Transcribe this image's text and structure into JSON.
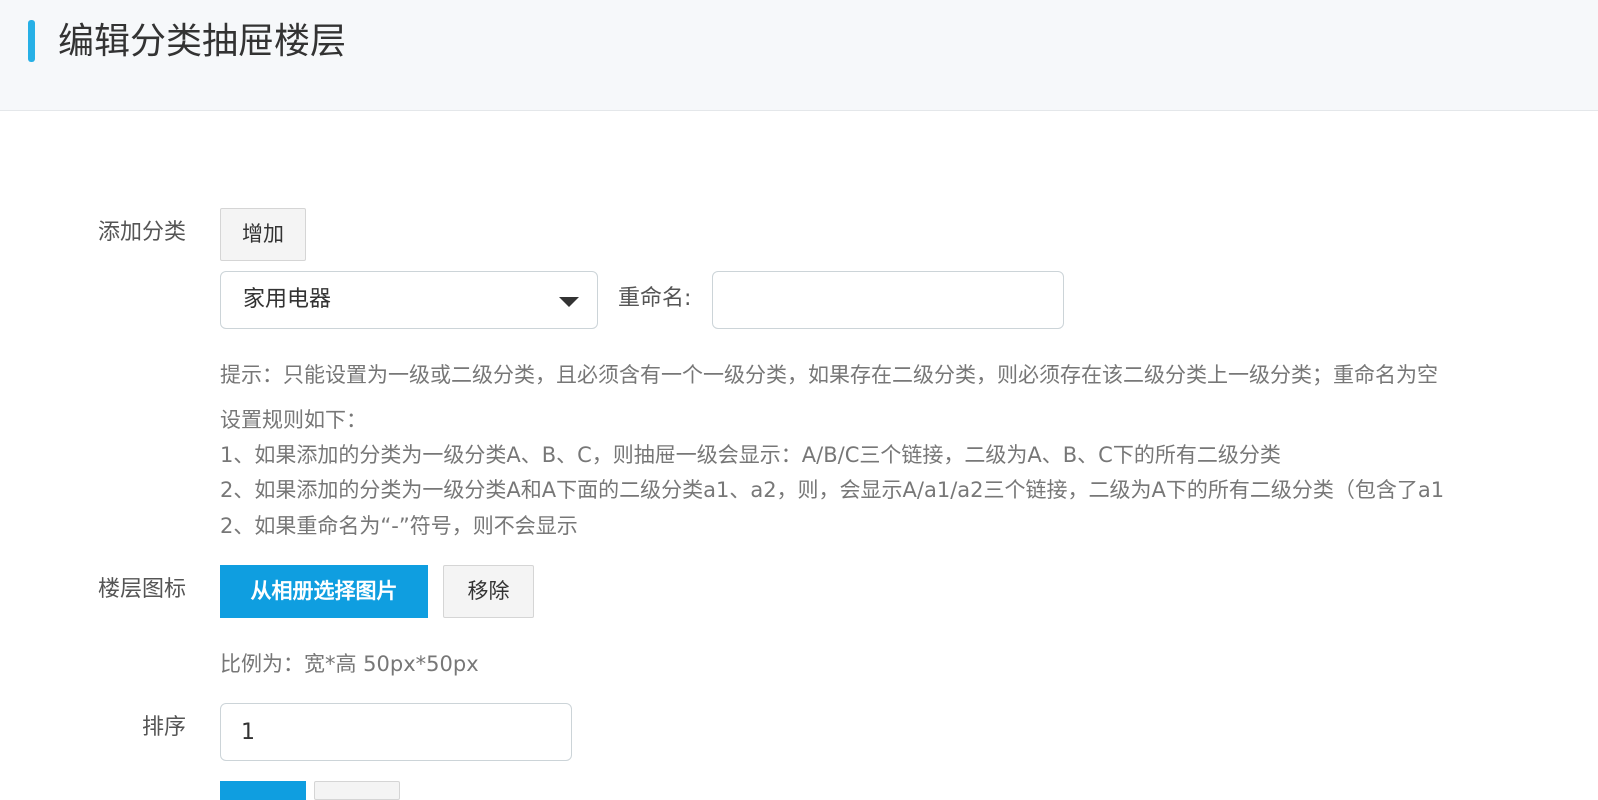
{
  "header": {
    "title": "编辑分类抽屉楼层"
  },
  "form": {
    "add_category": {
      "label": "添加分类",
      "add_button": "增加",
      "select_value": "家用电器",
      "rename_label": "重命名:",
      "rename_value": ""
    },
    "help": {
      "tip": "提示：只能设置为一级或二级分类，且必须含有一个一级分类，如果存在二级分类，则必须存在该二级分类上一级分类；重命名为空",
      "rules_title": "设置规则如下：",
      "rule1": "1、如果添加的分类为一级分类A、B、C，则抽屉一级会显示：A/B/C三个链接，二级为A、B、C下的所有二级分类",
      "rule2": "2、如果添加的分类为一级分类A和A下面的二级分类a1、a2，则，会显示A/a1/a2三个链接，二级为A下的所有二级分类（包含了a1",
      "rule3": "2、如果重命名为“-”符号，则不会显示"
    },
    "floor_icon": {
      "label": "楼层图标",
      "choose_button": "从相册选择图片",
      "remove_button": "移除",
      "ratio_hint": "比例为：宽*高 50px*50px"
    },
    "sort": {
      "label": "排序",
      "value": "1"
    }
  }
}
